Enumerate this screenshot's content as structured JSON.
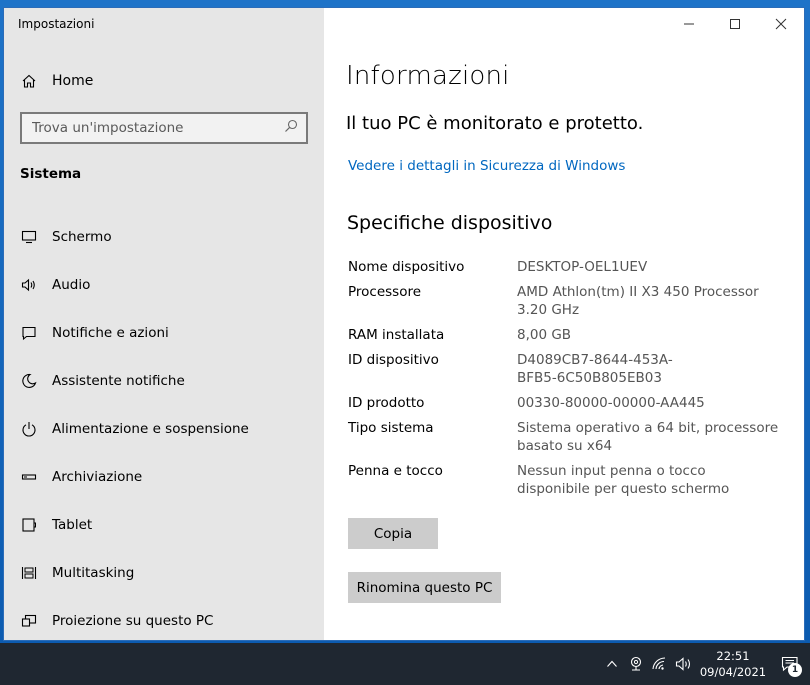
{
  "window": {
    "title": "Impostazioni"
  },
  "sidebar": {
    "home_label": "Home",
    "search_placeholder": "Trova un'impostazione",
    "section_heading": "Sistema",
    "items": [
      {
        "label": "Schermo",
        "icon": "monitor-icon"
      },
      {
        "label": "Audio",
        "icon": "speaker-icon"
      },
      {
        "label": "Notifiche e azioni",
        "icon": "notifications-icon"
      },
      {
        "label": "Assistente notifiche",
        "icon": "moon-icon"
      },
      {
        "label": "Alimentazione e sospensione",
        "icon": "power-icon"
      },
      {
        "label": "Archiviazione",
        "icon": "storage-icon"
      },
      {
        "label": "Tablet",
        "icon": "tablet-icon"
      },
      {
        "label": "Multitasking",
        "icon": "multitasking-icon"
      },
      {
        "label": "Proiezione su questo PC",
        "icon": "projection-icon"
      }
    ]
  },
  "content": {
    "page_title": "Informazioni",
    "protection_text": "Il tuo PC è monitorato e protetto.",
    "security_link": "Vedere i dettagli in Sicurezza di Windows",
    "specs_title": "Specifiche dispositivo",
    "specs": [
      {
        "label": "Nome dispositivo",
        "value": "DESKTOP-OEL1UEV"
      },
      {
        "label": "Processore",
        "value": "AMD Athlon(tm) II X3 450 Processor   3.20 GHz"
      },
      {
        "label": "RAM installata",
        "value": "8,00 GB"
      },
      {
        "label": "ID dispositivo",
        "value": "D4089CB7-8644-453A-BFB5-6C50B805EB03"
      },
      {
        "label": "ID prodotto",
        "value": "00330-80000-00000-AA445"
      },
      {
        "label": "Tipo sistema",
        "value": "Sistema operativo a 64 bit, processore basato su x64"
      },
      {
        "label": "Penna e tocco",
        "value": "Nessun input penna o tocco disponibile per questo schermo"
      }
    ],
    "copy_button": "Copia",
    "rename_button": "Rinomina questo PC"
  },
  "taskbar": {
    "time": "22:51",
    "date": "09/04/2021",
    "notification_count": "1"
  },
  "colors": {
    "accent_link": "#0067c0",
    "sidebar_bg": "#e6e6e6",
    "taskbar_bg": "#1f2731",
    "button_bg": "#cccccc"
  }
}
